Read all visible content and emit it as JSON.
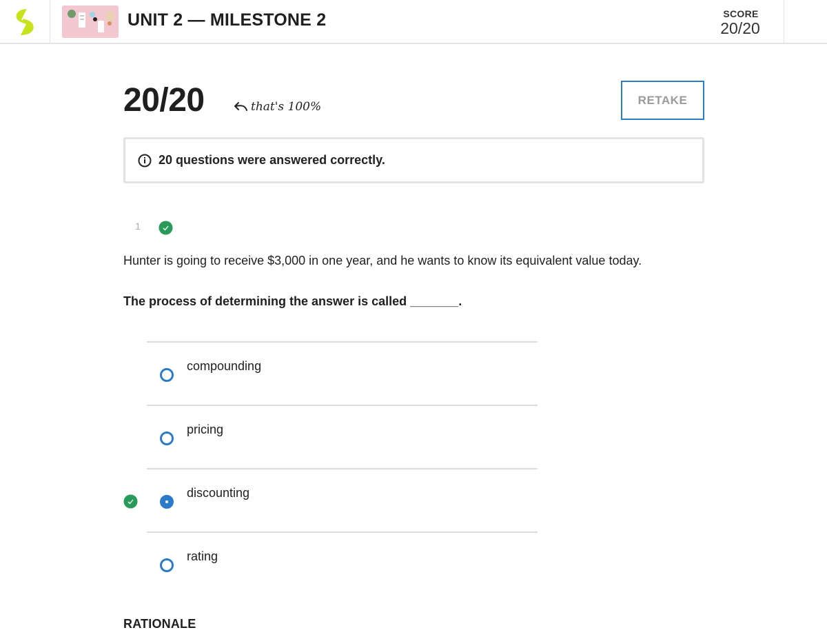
{
  "header": {
    "unit_title": "UNIT 2 — MILESTONE 2",
    "score_label": "SCORE",
    "score_value": "20/20",
    "logo_icon": "sophia-logo-icon",
    "thumbnail_icon": "course-thumbnail-image"
  },
  "result": {
    "big_score": "20/20",
    "note": "that's 100%",
    "retake_label": "RETAKE"
  },
  "info": {
    "count": "20",
    "message": " questions were answered correctly."
  },
  "question": {
    "number": "1",
    "text": "Hunter is going to receive $3,000 in one year, and he wants to know its equivalent value today.",
    "prompt": "The process of determining the answer is called _______.",
    "options": [
      {
        "label": "compounding",
        "selected": false,
        "correct": false
      },
      {
        "label": "pricing",
        "selected": false,
        "correct": false
      },
      {
        "label": "discounting",
        "selected": true,
        "correct": true
      },
      {
        "label": "rating",
        "selected": false,
        "correct": false
      }
    ]
  },
  "rationale_heading": "RATIONALE",
  "colors": {
    "accent_blue": "#2b7bc9",
    "correct_green": "#2a9a5b",
    "logo_lime": "#c8e21b",
    "thumbnail_pink": "#f3c7cf"
  }
}
